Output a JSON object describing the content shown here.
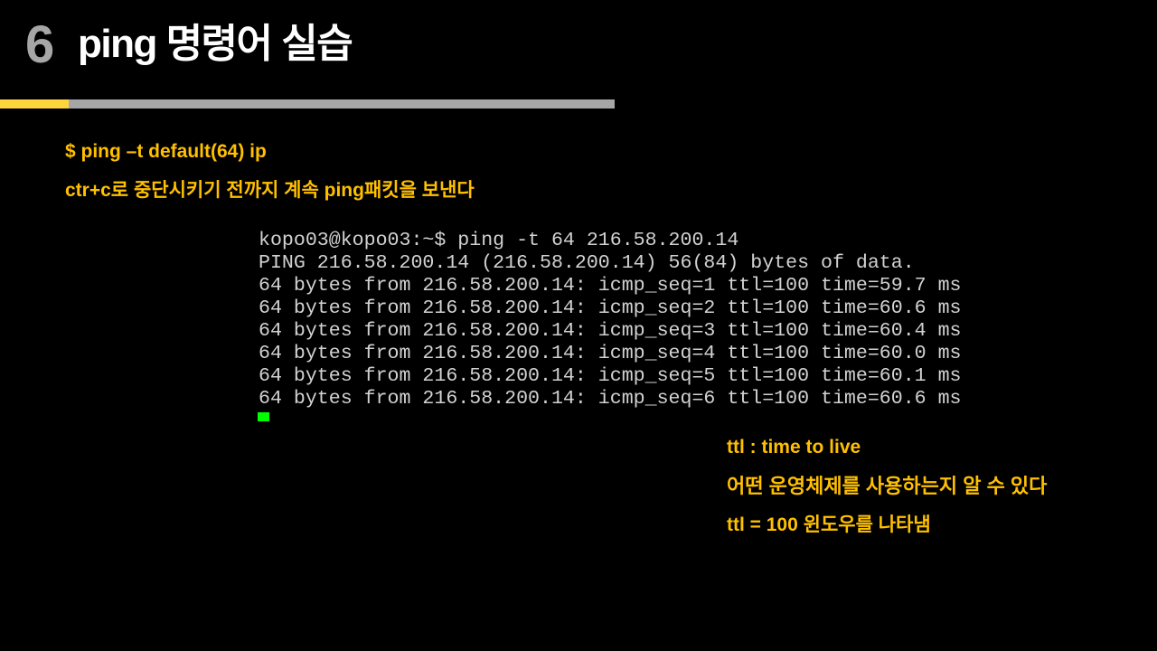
{
  "colors": {
    "background": "#000000",
    "accent_yellow": "#FFC000",
    "bar_yellow": "#FFD53D",
    "bar_gray": "#A6A6A6",
    "title_white": "#FFFFFF",
    "number_gray": "#A6A6A6",
    "terminal_text": "#D2D2D2",
    "cursor_green": "#00FF00"
  },
  "header": {
    "number": "6",
    "title": "ping 명령어 실습"
  },
  "notes_top": {
    "command": "$ ping –t default(64) ip",
    "description": "ctr+c로 중단시키기 전까지 계속 ping패킷을 보낸다"
  },
  "terminal": {
    "lines": [
      "kopo03@kopo03:~$ ping -t 64 216.58.200.14",
      "PING 216.58.200.14 (216.58.200.14) 56(84) bytes of data.",
      "64 bytes from 216.58.200.14: icmp_seq=1 ttl=100 time=59.7 ms",
      "64 bytes from 216.58.200.14: icmp_seq=2 ttl=100 time=60.6 ms",
      "64 bytes from 216.58.200.14: icmp_seq=3 ttl=100 time=60.4 ms",
      "64 bytes from 216.58.200.14: icmp_seq=4 ttl=100 time=60.0 ms",
      "64 bytes from 216.58.200.14: icmp_seq=5 ttl=100 time=60.1 ms",
      "64 bytes from 216.58.200.14: icmp_seq=6 ttl=100 time=60.6 ms"
    ]
  },
  "notes_bottom": {
    "ttl_definition": "ttl : time to live",
    "os_hint": "어떤 운영체제를 사용하는지 알 수 있다",
    "ttl_windows": "ttl = 100 윈도우를 나타냄"
  }
}
